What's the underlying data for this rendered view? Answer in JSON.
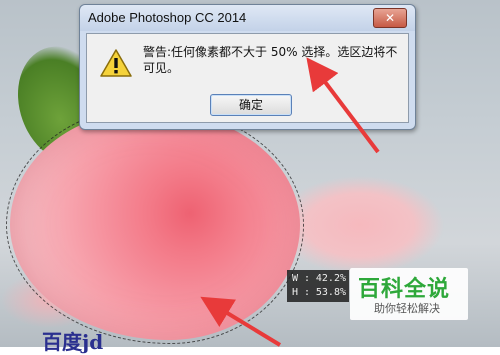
{
  "dialog": {
    "title": "Adobe Photoshop CC 2014",
    "message": "警告:任何像素都不大于 50% 选择。选区边将不可见。",
    "ok_label": "确定",
    "close_label": "✕"
  },
  "info_readout": {
    "w_label": "W :",
    "w_value": "42.2%",
    "h_label": "H :",
    "h_value": "53.8%"
  },
  "watermark": {
    "main": "百科全说",
    "sub": "助你轻松解决",
    "baidu": "百度jd"
  },
  "icons": [
    "warning-icon",
    "close-icon"
  ],
  "colors": {
    "arrow": "#e83a3a",
    "dialog_bg": "#f0f0f0",
    "title_bar": "#cfdcef",
    "logo_green": "#2ea83a"
  }
}
